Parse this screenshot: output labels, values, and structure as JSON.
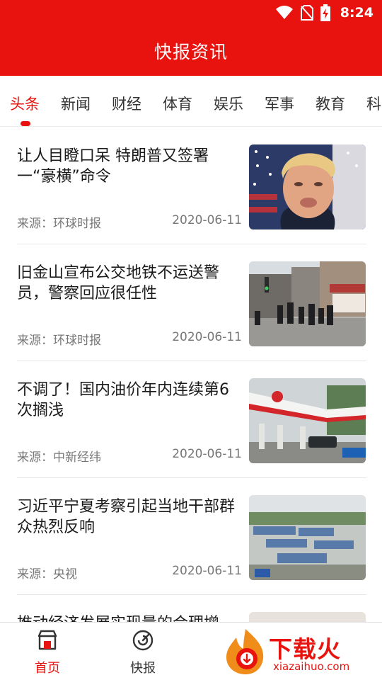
{
  "status_bar": {
    "time": "8:24",
    "icons": [
      "wifi-icon",
      "no-sim-icon",
      "battery-charging-icon"
    ]
  },
  "app": {
    "title": "快报资讯"
  },
  "tabs": [
    {
      "label": "头条",
      "active": true
    },
    {
      "label": "新闻"
    },
    {
      "label": "财经"
    },
    {
      "label": "体育"
    },
    {
      "label": "娱乐"
    },
    {
      "label": "军事"
    },
    {
      "label": "教育"
    },
    {
      "label": "科"
    }
  ],
  "news": [
    {
      "title": "让人目瞪口呆 特朗普又签署一“豪横”命令",
      "source": "来源：环球时报",
      "date": "2020-06-11",
      "image": "portrait-photo"
    },
    {
      "title": "旧金山宣布公交地铁不运送警员，警察回应很任性",
      "source": "来源：环球时报",
      "date": "2020-06-11",
      "image": "street-photo"
    },
    {
      "title": "不调了！国内油价年内连续第6次搁浅",
      "source": "来源：中新经纬",
      "date": "2020-06-11",
      "image": "gas-station-photo"
    },
    {
      "title": "习近平宁夏考察引起当地干部群众热烈反响",
      "source": "来源：央视",
      "date": "2020-06-11",
      "image": "village-aerial-photo"
    },
    {
      "title": "推动经济发展实现量的合理增",
      "source": "",
      "date": "",
      "image": "news-photo"
    }
  ],
  "bottom_nav": [
    {
      "label": "首页",
      "icon": "home-store-icon",
      "active": true
    },
    {
      "label": "快报",
      "icon": "radar-gauge-icon"
    }
  ],
  "watermark": {
    "text": "下载火",
    "url": "xiazaihuo.com"
  },
  "colors": {
    "brand_red": "#e8130f",
    "text": "#1a1a1a",
    "muted": "#777777",
    "divider": "#e6e6e6"
  }
}
